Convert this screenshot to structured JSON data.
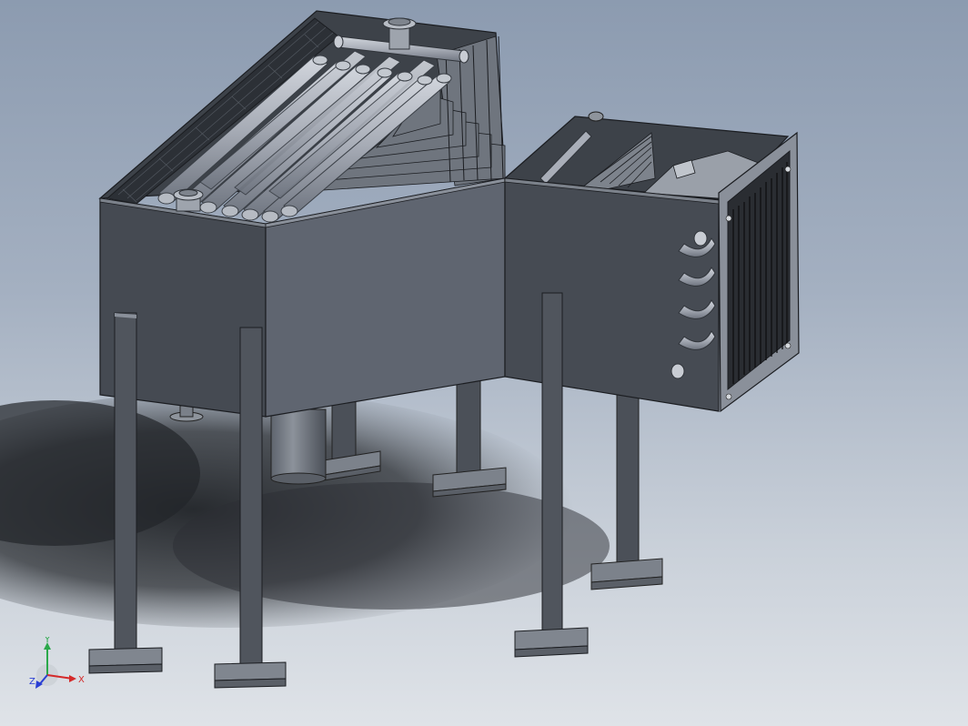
{
  "viewport": {
    "background_top": "#8c9bb0",
    "background_bottom": "#dfe3e8"
  },
  "model": {
    "body_color": "#545b66",
    "body_dark_color": "#3e434b",
    "tube_color": "#a9aeb8",
    "fin_color": "#1b1d21"
  },
  "triad": {
    "x_label": "X",
    "y_label": "Y",
    "z_label": "Z",
    "x_color": "#d42a2a",
    "y_color": "#2aa84a",
    "z_color": "#2a3fd4"
  }
}
